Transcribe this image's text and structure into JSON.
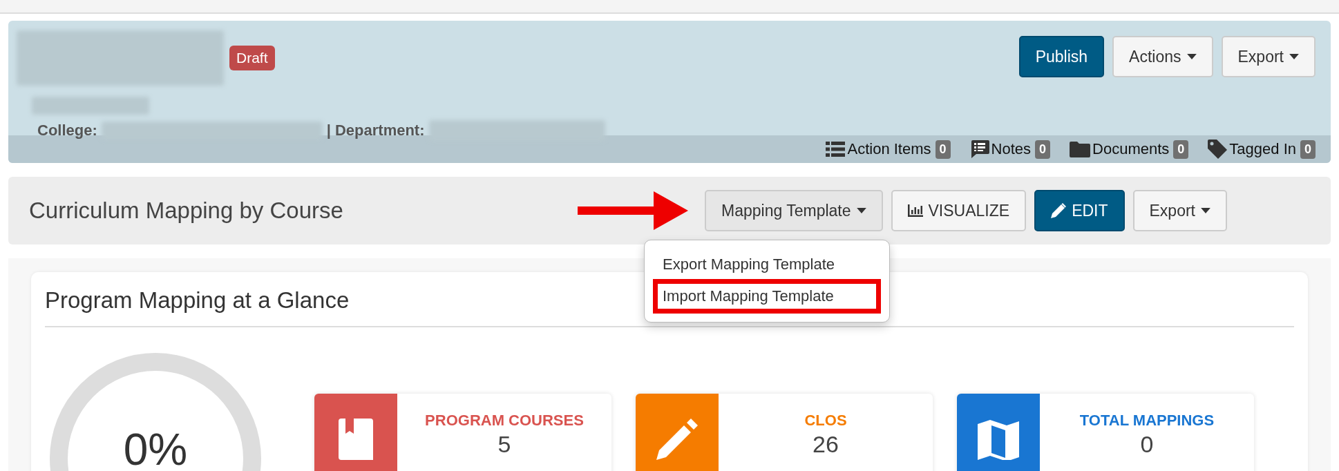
{
  "record": {
    "status_badge": "Draft",
    "college_label": "College:",
    "separator": "|",
    "department_label": "Department:"
  },
  "header_buttons": [
    {
      "label": "Publish",
      "kind": "primary"
    },
    {
      "label": "Actions",
      "kind": "dropdown"
    },
    {
      "label": "Export",
      "kind": "dropdown"
    }
  ],
  "record_links": [
    {
      "label": "Action Items",
      "count": "0",
      "kind": "list"
    },
    {
      "label": "Notes",
      "count": "0",
      "kind": "comment"
    },
    {
      "label": "Documents",
      "count": "0",
      "kind": "folder"
    },
    {
      "label": "Tagged In",
      "count": "0",
      "kind": "tag"
    }
  ],
  "section": {
    "title": "Curriculum Mapping by Course",
    "buttons": [
      {
        "label": "Mapping Template",
        "kind": "dropdown",
        "expanded": true
      },
      {
        "label": "VISUALIZE",
        "kind": "chart"
      },
      {
        "label": "EDIT",
        "kind": "edit"
      },
      {
        "label": "Export",
        "kind": "dropdown",
        "expanded": false
      }
    ],
    "menu": [
      {
        "label": "Export Mapping Template",
        "highlighted": false
      },
      {
        "label": "Import Mapping Template",
        "highlighted": true
      }
    ]
  },
  "card": {
    "title": "Program Mapping at a Glance",
    "progress": {
      "level": 0,
      "reading": "0%"
    },
    "stats": [
      {
        "label": "PROGRAM COURSES",
        "value": "5",
        "kind": "book",
        "color": "#d9534f"
      },
      {
        "label": "CLOS",
        "value": "26",
        "kind": "pencil",
        "color": "#f57c00"
      },
      {
        "label": "TOTAL MAPPINGS",
        "value": "0",
        "kind": "map",
        "color": "#1976d2"
      }
    ]
  }
}
